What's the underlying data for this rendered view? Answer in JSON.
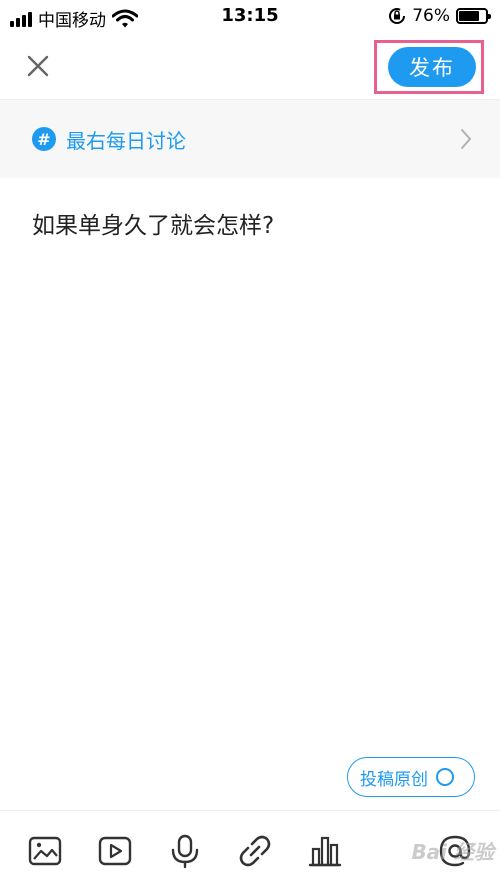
{
  "status_bar": {
    "carrier": "中国移动",
    "time": "13:15",
    "battery_percent": "76%",
    "battery_level": 0.76,
    "icons": [
      "signal-icon",
      "wifi-icon",
      "rotation-lock-icon",
      "battery-icon"
    ]
  },
  "header": {
    "close_icon": "close-icon",
    "publish_label": "发布"
  },
  "topic": {
    "label": "最右每日讨论",
    "icon": "hash-icon",
    "chevron": "chevron-right-icon"
  },
  "post": {
    "text": "如果单身久了就会怎样?"
  },
  "original_toggle": {
    "label": "投稿原创"
  },
  "toolbar": {
    "items": [
      "image-icon",
      "video-icon",
      "microphone-icon",
      "link-icon",
      "vote-icon",
      "mention-icon"
    ]
  },
  "colors": {
    "accent": "#1e9bf0",
    "highlight": "#e8608e",
    "topic_background": "#f7f7f7"
  },
  "watermark": "Bai 经验"
}
